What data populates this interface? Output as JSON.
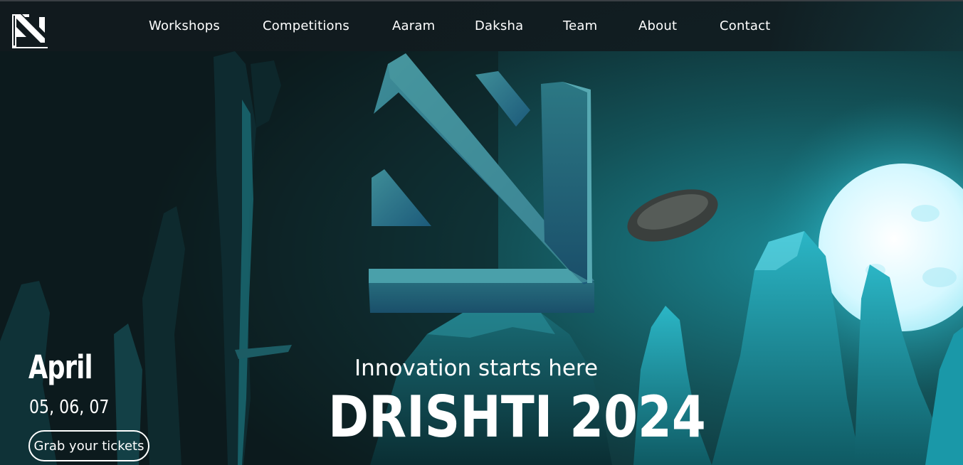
{
  "brand": {
    "logo_icon": "drishti-logo-icon"
  },
  "nav": {
    "items": [
      {
        "label": "Workshops"
      },
      {
        "label": "Competitions"
      },
      {
        "label": "Aaram"
      },
      {
        "label": "Daksha"
      },
      {
        "label": "Team"
      },
      {
        "label": "About"
      },
      {
        "label": "Contact"
      }
    ]
  },
  "hero": {
    "tagline": "Innovation starts here",
    "title": "DRISHTI 2024",
    "date_month": "April",
    "date_days": "05, 06, 07",
    "cta_label": "Grab your tickets"
  },
  "colors": {
    "background": "#0d1e21",
    "accent_teal": "#1fb3c4",
    "moon": "#d9f8ff",
    "text": "#ffffff"
  }
}
